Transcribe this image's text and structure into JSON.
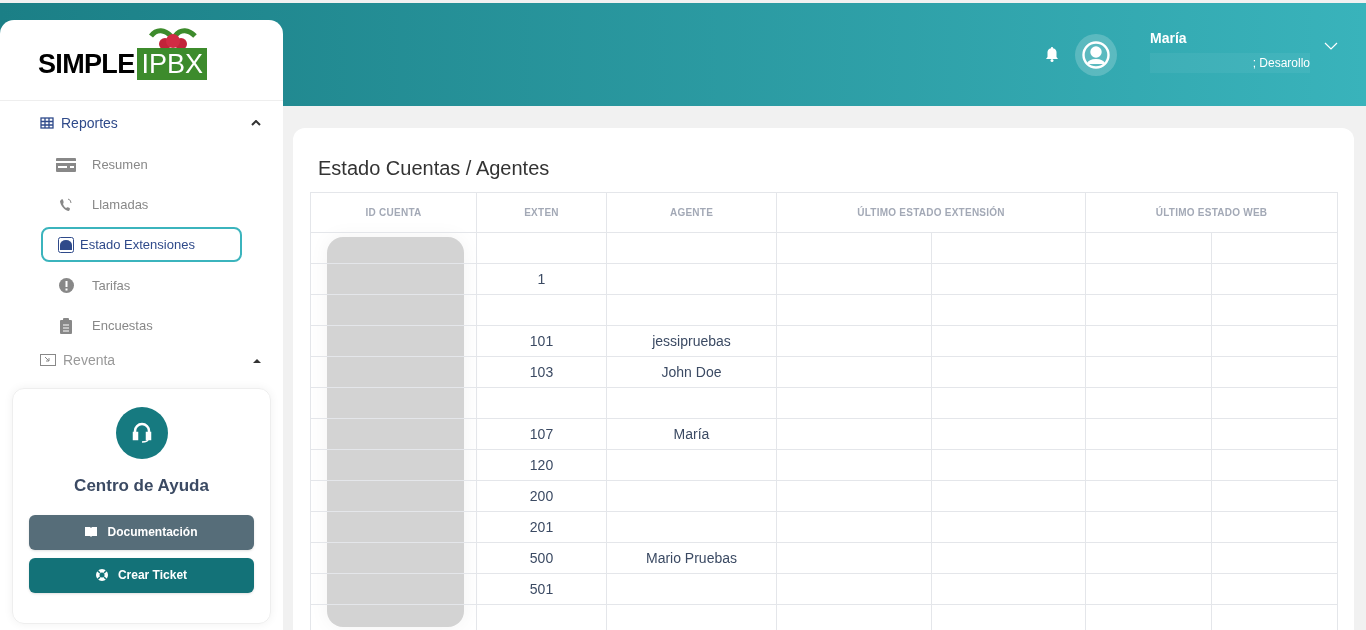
{
  "logo": {
    "word_1": "SIMPLE",
    "word_2": "IPBX"
  },
  "header": {
    "user_name": "María",
    "user_role": "; Desarollo"
  },
  "sidebar": {
    "sections": [
      {
        "label": "Reportes",
        "expanded": true,
        "items": [
          {
            "label": "Resumen",
            "selected": false
          },
          {
            "label": "Llamadas",
            "selected": false
          },
          {
            "label": "Estado Extensiones",
            "selected": true
          },
          {
            "label": "Tarifas",
            "selected": false
          },
          {
            "label": "Encuestas",
            "selected": false
          }
        ]
      },
      {
        "label": "Reventa",
        "expanded": false
      }
    ]
  },
  "help": {
    "title": "Centro de Ayuda",
    "buttons": [
      {
        "label": "Documentación",
        "kind": "docs"
      },
      {
        "label": "Crear Ticket",
        "kind": "ticket"
      }
    ]
  },
  "page": {
    "title": "Estado Cuentas / Agentes"
  },
  "table": {
    "columns": [
      "ID CUENTA",
      "EXTEN",
      "AGENTE",
      "ÚLTIMO ESTADO EXTENSIÓN",
      "ÚLTIMO ESTADO WEB"
    ],
    "rows": [
      {
        "exten": "",
        "agent": ""
      },
      {
        "exten": "1",
        "agent": ""
      },
      {
        "exten": "",
        "agent": ""
      },
      {
        "exten": "101",
        "agent": "jessipruebas"
      },
      {
        "exten": "103",
        "agent": "John Doe"
      },
      {
        "exten": "",
        "agent": ""
      },
      {
        "exten": "107",
        "agent": "María"
      },
      {
        "exten": "120",
        "agent": ""
      },
      {
        "exten": "200",
        "agent": ""
      },
      {
        "exten": "201",
        "agent": ""
      },
      {
        "exten": "500",
        "agent": "Mario Pruebas"
      },
      {
        "exten": "501",
        "agent": ""
      },
      {
        "exten": "",
        "agent": ""
      }
    ]
  }
}
